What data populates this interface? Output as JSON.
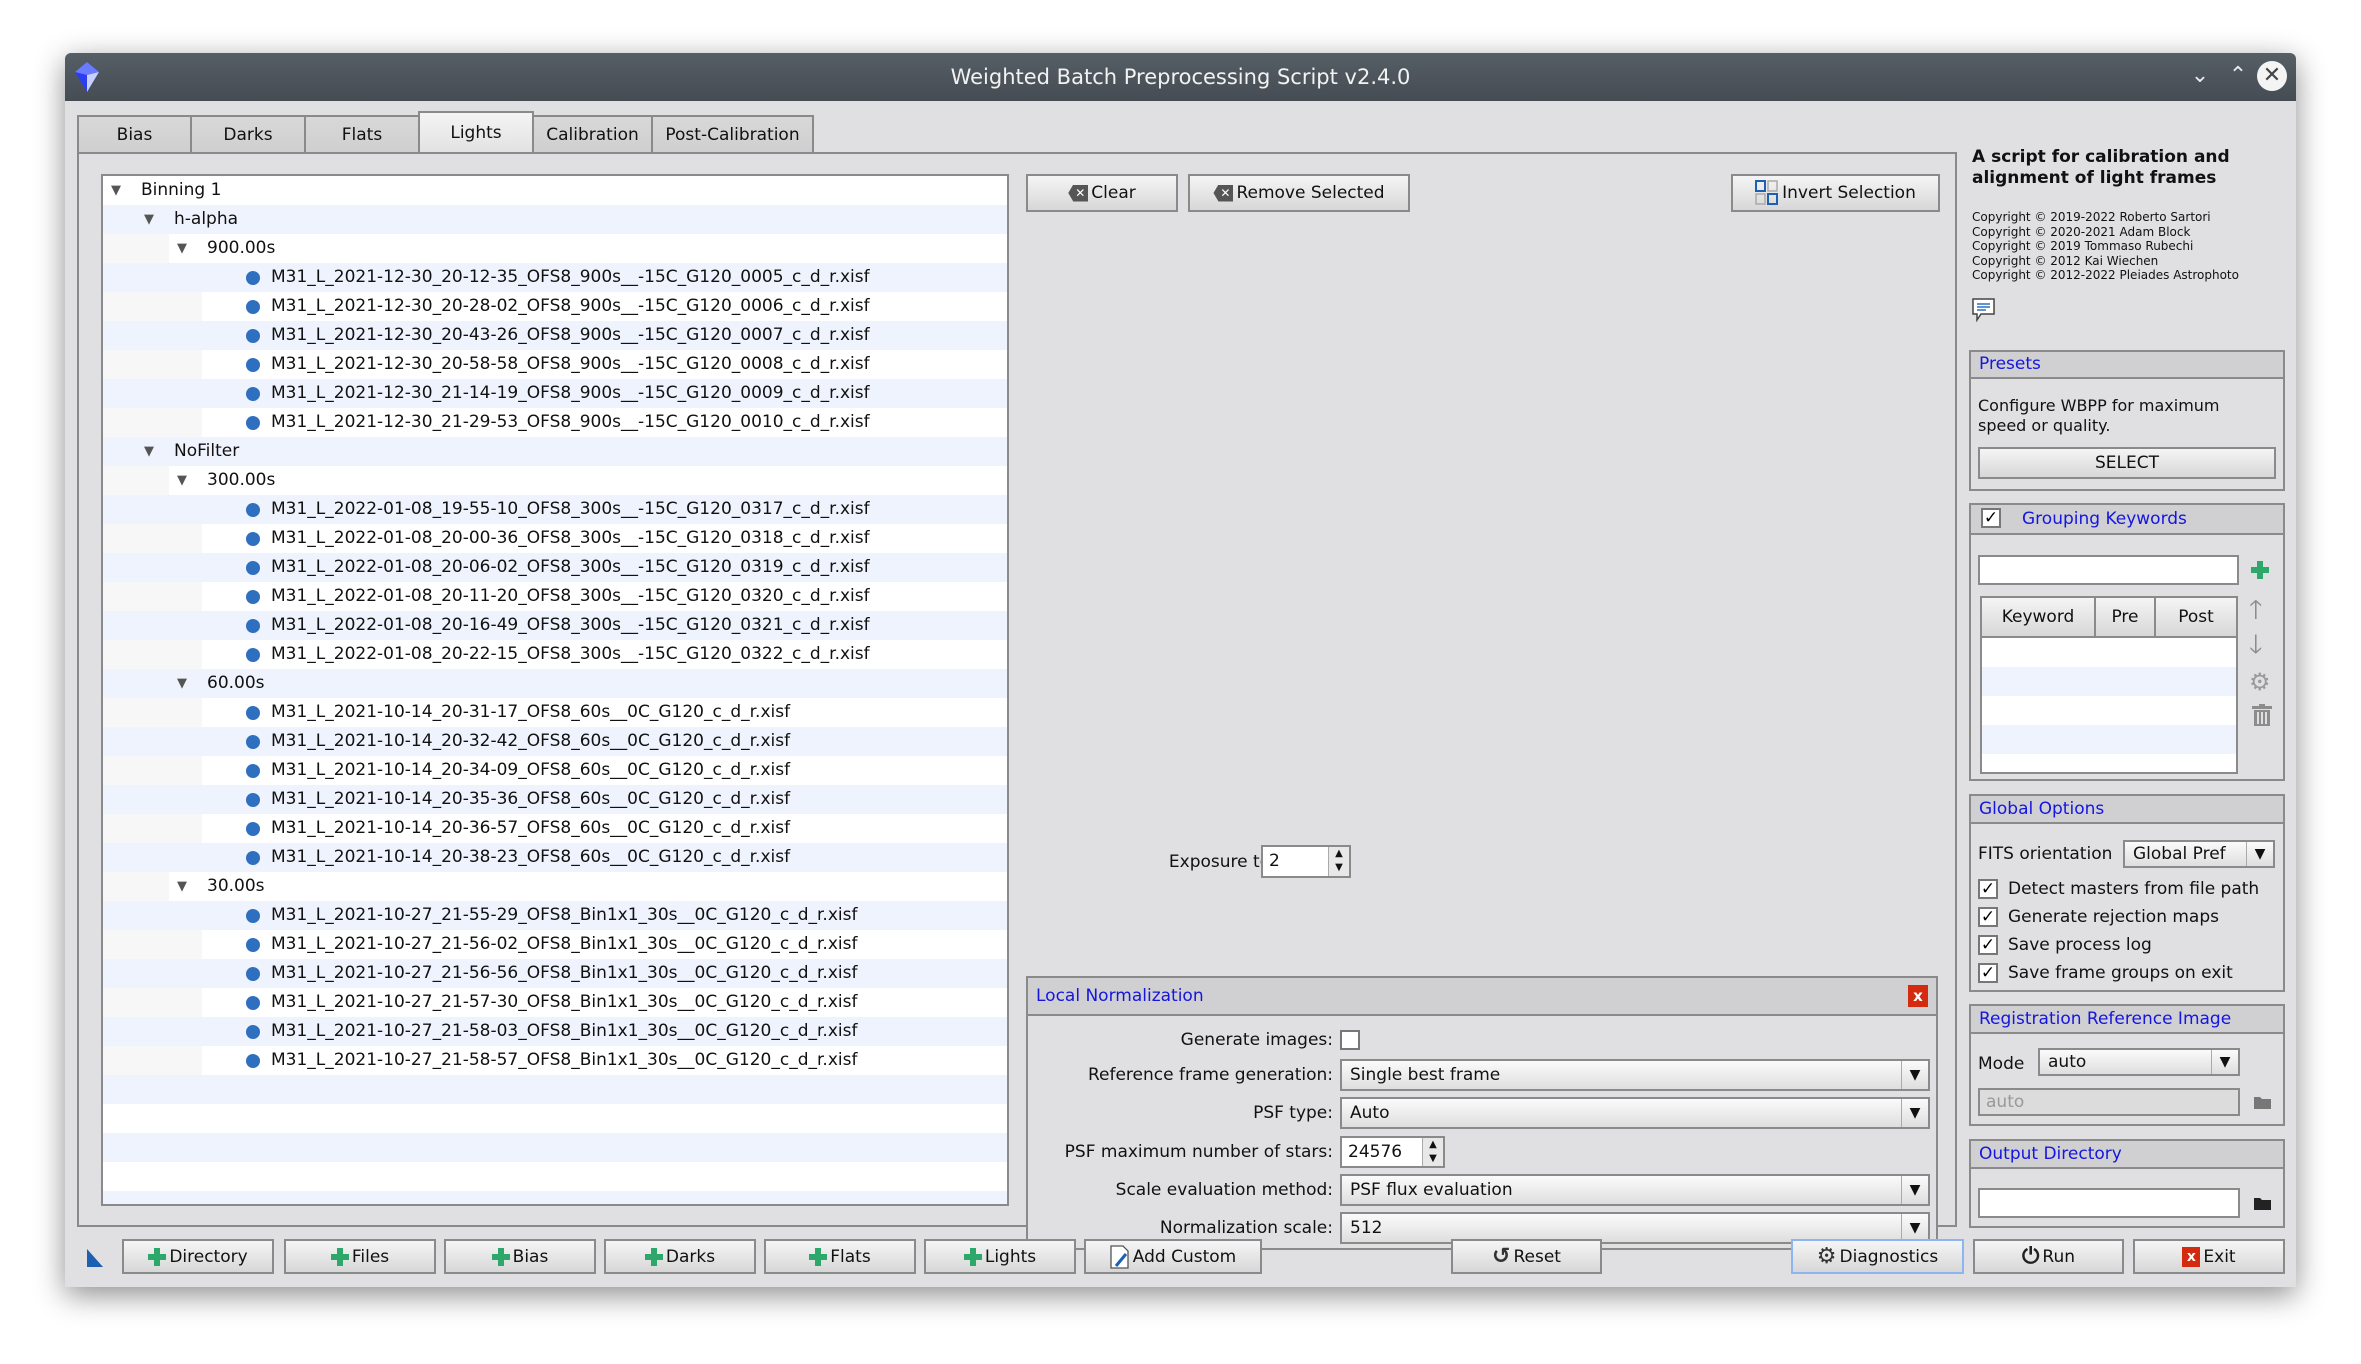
{
  "window": {
    "title": "Weighted Batch Preprocessing Script v2.4.0",
    "controls": {
      "minimize": "⌄",
      "maximize": "⌃",
      "close": "✕"
    }
  },
  "tabs": [
    {
      "label": "Bias",
      "active": false
    },
    {
      "label": "Darks",
      "active": false
    },
    {
      "label": "Flats",
      "active": false
    },
    {
      "label": "Lights",
      "active": true
    },
    {
      "label": "Calibration",
      "active": false
    },
    {
      "label": "Post-Calibration",
      "active": false
    }
  ],
  "tree": {
    "rows": [
      {
        "level": 0,
        "type": "group",
        "label": "Binning 1"
      },
      {
        "level": 1,
        "type": "group",
        "label": "h-alpha"
      },
      {
        "level": 2,
        "type": "group",
        "label": "900.00s"
      },
      {
        "level": 3,
        "type": "file",
        "label": "M31_L_2021-12-30_20-12-35_OFS8_900s__-15C_G120_0005_c_d_r.xisf"
      },
      {
        "level": 3,
        "type": "file",
        "label": "M31_L_2021-12-30_20-28-02_OFS8_900s__-15C_G120_0006_c_d_r.xisf"
      },
      {
        "level": 3,
        "type": "file",
        "label": "M31_L_2021-12-30_20-43-26_OFS8_900s__-15C_G120_0007_c_d_r.xisf"
      },
      {
        "level": 3,
        "type": "file",
        "label": "M31_L_2021-12-30_20-58-58_OFS8_900s__-15C_G120_0008_c_d_r.xisf"
      },
      {
        "level": 3,
        "type": "file",
        "label": "M31_L_2021-12-30_21-14-19_OFS8_900s__-15C_G120_0009_c_d_r.xisf"
      },
      {
        "level": 3,
        "type": "file",
        "label": "M31_L_2021-12-30_21-29-53_OFS8_900s__-15C_G120_0010_c_d_r.xisf"
      },
      {
        "level": 1,
        "type": "group",
        "label": "NoFilter"
      },
      {
        "level": 2,
        "type": "group",
        "label": "300.00s"
      },
      {
        "level": 3,
        "type": "file",
        "label": "M31_L_2022-01-08_19-55-10_OFS8_300s__-15C_G120_0317_c_d_r.xisf"
      },
      {
        "level": 3,
        "type": "file",
        "label": "M31_L_2022-01-08_20-00-36_OFS8_300s__-15C_G120_0318_c_d_r.xisf"
      },
      {
        "level": 3,
        "type": "file",
        "label": "M31_L_2022-01-08_20-06-02_OFS8_300s__-15C_G120_0319_c_d_r.xisf"
      },
      {
        "level": 3,
        "type": "file",
        "label": "M31_L_2022-01-08_20-11-20_OFS8_300s__-15C_G120_0320_c_d_r.xisf"
      },
      {
        "level": 3,
        "type": "file",
        "label": "M31_L_2022-01-08_20-16-49_OFS8_300s__-15C_G120_0321_c_d_r.xisf"
      },
      {
        "level": 3,
        "type": "file",
        "label": "M31_L_2022-01-08_20-22-15_OFS8_300s__-15C_G120_0322_c_d_r.xisf"
      },
      {
        "level": 2,
        "type": "group",
        "label": "60.00s"
      },
      {
        "level": 3,
        "type": "file",
        "label": "M31_L_2021-10-14_20-31-17_OFS8_60s__0C_G120_c_d_r.xisf"
      },
      {
        "level": 3,
        "type": "file",
        "label": "M31_L_2021-10-14_20-32-42_OFS8_60s__0C_G120_c_d_r.xisf"
      },
      {
        "level": 3,
        "type": "file",
        "label": "M31_L_2021-10-14_20-34-09_OFS8_60s__0C_G120_c_d_r.xisf"
      },
      {
        "level": 3,
        "type": "file",
        "label": "M31_L_2021-10-14_20-35-36_OFS8_60s__0C_G120_c_d_r.xisf"
      },
      {
        "level": 3,
        "type": "file",
        "label": "M31_L_2021-10-14_20-36-57_OFS8_60s__0C_G120_c_d_r.xisf"
      },
      {
        "level": 3,
        "type": "file",
        "label": "M31_L_2021-10-14_20-38-23_OFS8_60s__0C_G120_c_d_r.xisf"
      },
      {
        "level": 2,
        "type": "group",
        "label": "30.00s"
      },
      {
        "level": 3,
        "type": "file",
        "label": "M31_L_2021-10-27_21-55-29_OFS8_Bin1x1_30s__0C_G120_c_d_r.xisf"
      },
      {
        "level": 3,
        "type": "file",
        "label": "M31_L_2021-10-27_21-56-02_OFS8_Bin1x1_30s__0C_G120_c_d_r.xisf"
      },
      {
        "level": 3,
        "type": "file",
        "label": "M31_L_2021-10-27_21-56-56_OFS8_Bin1x1_30s__0C_G120_c_d_r.xisf"
      },
      {
        "level": 3,
        "type": "file",
        "label": "M31_L_2021-10-27_21-57-30_OFS8_Bin1x1_30s__0C_G120_c_d_r.xisf"
      },
      {
        "level": 3,
        "type": "file",
        "label": "M31_L_2021-10-27_21-58-03_OFS8_Bin1x1_30s__0C_G120_c_d_r.xisf"
      },
      {
        "level": 3,
        "type": "file",
        "label": "M31_L_2021-10-27_21-58-57_OFS8_Bin1x1_30s__0C_G120_c_d_r.xisf"
      }
    ]
  },
  "list_actions": {
    "clear": "Clear",
    "remove_selected": "Remove Selected",
    "invert_selection": "Invert Selection"
  },
  "exposure_tolerance": {
    "label": "Exposure tolerance:",
    "value": "2"
  },
  "local_normalization": {
    "title": "Local Normalization",
    "generate_images": {
      "label": "Generate images:",
      "checked": false
    },
    "reference_frame_generation": {
      "label": "Reference frame generation:",
      "value": "Single best frame"
    },
    "psf_type": {
      "label": "PSF type:",
      "value": "Auto"
    },
    "psf_max_stars": {
      "label": "PSF maximum number of stars:",
      "value": "24576"
    },
    "scale_evaluation_method": {
      "label": "Scale evaluation method:",
      "value": "PSF flux evaluation"
    },
    "normalization_scale": {
      "label": "Normalization scale:",
      "value": "512"
    }
  },
  "about": {
    "heading": "A script for calibration and alignment of light frames",
    "copyrights": [
      "Copyright © 2019-2022 Roberto Sartori",
      "Copyright © 2020-2021 Adam Block",
      "Copyright © 2019 Tommaso Rubechi",
      "Copyright © 2012 Kai Wiechen",
      "Copyright © 2012-2022 Pleiades Astrophoto"
    ]
  },
  "presets": {
    "title": "Presets",
    "description": "Configure WBPP for maximum speed or quality.",
    "select_label": "SELECT"
  },
  "grouping_keywords": {
    "title": "Grouping Keywords",
    "enabled": true,
    "input_value": "",
    "columns": [
      "Keyword",
      "Pre",
      "Post"
    ],
    "rows": []
  },
  "global_options": {
    "title": "Global Options",
    "fits_orientation": {
      "label": "FITS orientation",
      "value": "Global Pref"
    },
    "options": [
      {
        "label": "Detect masters from file path",
        "checked": true
      },
      {
        "label": "Generate rejection maps",
        "checked": true
      },
      {
        "label": "Save process log",
        "checked": true
      },
      {
        "label": "Save frame groups on exit",
        "checked": true
      }
    ]
  },
  "registration_reference": {
    "title": "Registration Reference Image",
    "mode_label": "Mode",
    "mode_value": "auto",
    "path_placeholder": "auto"
  },
  "output_directory": {
    "title": "Output Directory",
    "value": ""
  },
  "bottom_bar": {
    "add_buttons": [
      "Directory",
      "Files",
      "Bias",
      "Darks",
      "Flats",
      "Lights"
    ],
    "add_custom": "Add Custom",
    "reset": "Reset",
    "diagnostics": "Diagnostics",
    "run": "Run",
    "exit": "Exit"
  },
  "colors": {
    "group_title": "#1515e0",
    "file_dot": "#2f6fbf",
    "add_icon": "#2ea86a",
    "exit_icon": "#d42a0f",
    "titlebar": "#4d545b"
  }
}
